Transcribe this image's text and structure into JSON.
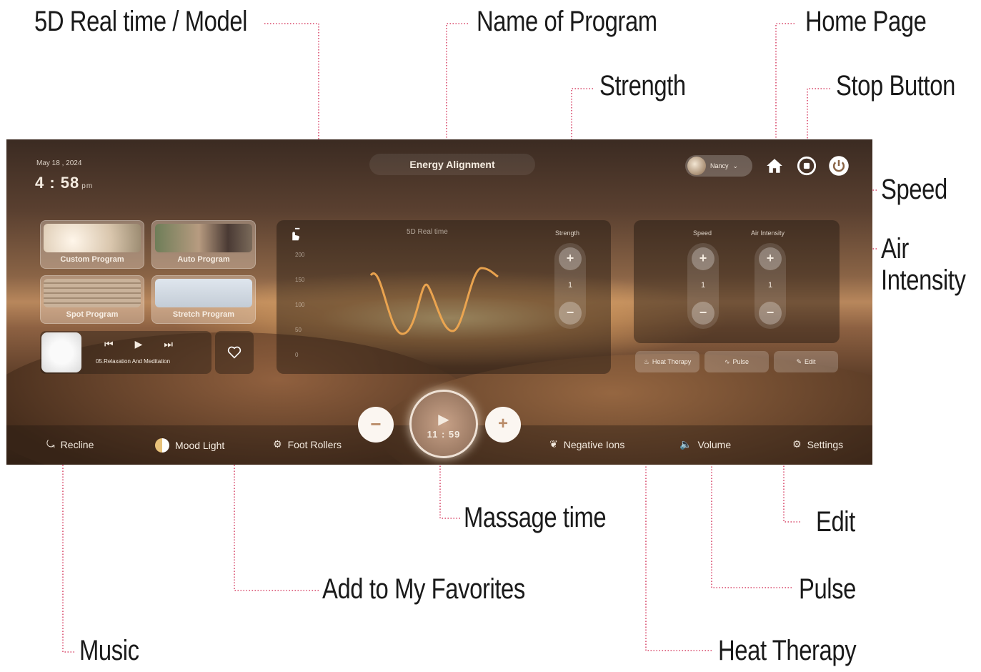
{
  "callouts": {
    "model": "5D Real time / Model",
    "program_name": "Name of Program",
    "home_page": "Home Page",
    "strength": "Strength",
    "stop_button": "Stop Button",
    "speed": "Speed",
    "air_intensity": "Air Intensity",
    "massage_time": "Massage time",
    "edit": "Edit",
    "add_favorites": "Add to My Favorites",
    "pulse": "Pulse",
    "music": "Music",
    "heat_therapy": "Heat Therapy"
  },
  "header": {
    "date": "May 18 , 2024",
    "time": "4 : 58",
    "ampm": "pm",
    "program_name": "Energy Alignment",
    "user": "Nancy"
  },
  "programs": {
    "custom": "Custom Program",
    "auto": "Auto Program",
    "spot": "Spot Program",
    "stretch": "Stretch Program"
  },
  "music": {
    "track": "05.Relaxation And Meditation",
    "prev": "⏮",
    "play": "▶",
    "next": "⏭"
  },
  "chart": {
    "title": "5D Real time",
    "y_ticks": [
      "200",
      "150",
      "100",
      "50",
      "0"
    ]
  },
  "controls": {
    "strength_label": "Strength",
    "strength_value": "1",
    "speed_label": "Speed",
    "speed_value": "1",
    "air_label": "Air Intensity",
    "air_value": "1",
    "plus": "+",
    "minus": "−"
  },
  "options": {
    "heat": "Heat Therapy",
    "pulse": "Pulse",
    "edit": "Edit"
  },
  "timer": {
    "value": "11 : 59"
  },
  "bottom_bar": {
    "recline": "Recline",
    "mood_light": "Mood Light",
    "foot_rollers": "Foot Rollers",
    "negative_ions": "Negative Ions",
    "volume": "Volume",
    "settings": "Settings"
  },
  "colors": {
    "leader": "#d0204a",
    "wave": "#f0a850"
  }
}
